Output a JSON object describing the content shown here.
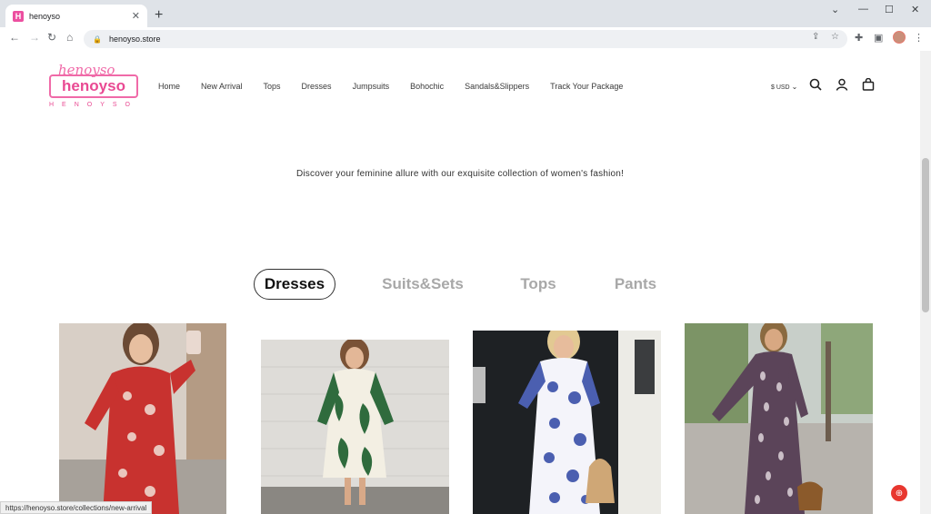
{
  "browser": {
    "tab_title": "henoyso",
    "favicon_letter": "H",
    "url": "henoyso.store",
    "status_url": "https://henoyso.store/collections/new-arrival"
  },
  "header": {
    "logo_script": "henoyso",
    "logo_main": "henoyso",
    "logo_spaced": "HENOYSO",
    "nav": [
      "Home",
      "New Arrival",
      "Tops",
      "Dresses",
      "Jumpsuits",
      "Bohochic",
      "Sandals&Slippers",
      "Track Your Package"
    ],
    "currency": "$ USD"
  },
  "tagline": "Discover your feminine allure with our exquisite collection of women's fashion!",
  "category_tabs": [
    "Dresses",
    "Suits&Sets",
    "Tops",
    "Pants"
  ],
  "active_tab": "Dresses",
  "colors": {
    "brand": "#e94a93",
    "fab": "#e8372f"
  },
  "icons": [
    "search-icon",
    "account-icon",
    "cart-icon",
    "chevron-down-icon"
  ]
}
